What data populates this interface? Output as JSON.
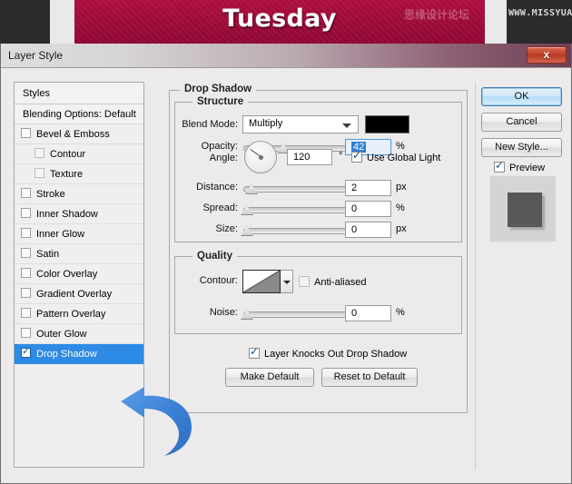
{
  "banner": {
    "title": "Tuesday",
    "watermark_cn": "思缘设计论坛",
    "watermark_en": "WWW.MISSYUAN.COM",
    "bg_color": "#9d0a38"
  },
  "window": {
    "title": "Layer Style",
    "close_label": "x"
  },
  "styles_list": {
    "header": "Styles",
    "blending_options": "Blending Options: Default",
    "items": [
      {
        "label": "Bevel & Emboss",
        "checked": false,
        "sub": false,
        "selected": false
      },
      {
        "label": "Contour",
        "checked": false,
        "sub": true,
        "selected": false
      },
      {
        "label": "Texture",
        "checked": false,
        "sub": true,
        "selected": false
      },
      {
        "label": "Stroke",
        "checked": false,
        "sub": false,
        "selected": false
      },
      {
        "label": "Inner Shadow",
        "checked": false,
        "sub": false,
        "selected": false
      },
      {
        "label": "Inner Glow",
        "checked": false,
        "sub": false,
        "selected": false
      },
      {
        "label": "Satin",
        "checked": false,
        "sub": false,
        "selected": false
      },
      {
        "label": "Color Overlay",
        "checked": false,
        "sub": false,
        "selected": false
      },
      {
        "label": "Gradient Overlay",
        "checked": false,
        "sub": false,
        "selected": false
      },
      {
        "label": "Pattern Overlay",
        "checked": false,
        "sub": false,
        "selected": false
      },
      {
        "label": "Outer Glow",
        "checked": false,
        "sub": false,
        "selected": false
      },
      {
        "label": "Drop Shadow",
        "checked": true,
        "sub": false,
        "selected": true
      }
    ]
  },
  "panel": {
    "group_title": "Drop Shadow",
    "structure": {
      "legend": "Structure",
      "blend_mode_label": "Blend Mode:",
      "blend_mode_value": "Multiply",
      "shadow_color": "#000000",
      "opacity_label": "Opacity:",
      "opacity_value": "42",
      "opacity_unit": "%",
      "angle_label": "Angle:",
      "angle_value": "120",
      "angle_unit": "°",
      "use_global_light_label": "Use Global Light",
      "use_global_light_checked": true,
      "distance_label": "Distance:",
      "distance_value": "2",
      "distance_unit": "px",
      "spread_label": "Spread:",
      "spread_value": "0",
      "spread_unit": "%",
      "size_label": "Size:",
      "size_value": "0",
      "size_unit": "px"
    },
    "quality": {
      "legend": "Quality",
      "contour_label": "Contour:",
      "anti_aliased_label": "Anti-aliased",
      "anti_aliased_checked": false,
      "noise_label": "Noise:",
      "noise_value": "0",
      "noise_unit": "%"
    },
    "knockout_label": "Layer Knocks Out Drop Shadow",
    "knockout_checked": true,
    "make_default_label": "Make Default",
    "reset_default_label": "Reset to Default"
  },
  "right": {
    "ok_label": "OK",
    "cancel_label": "Cancel",
    "new_style_label": "New Style...",
    "preview_label": "Preview",
    "preview_checked": true
  }
}
